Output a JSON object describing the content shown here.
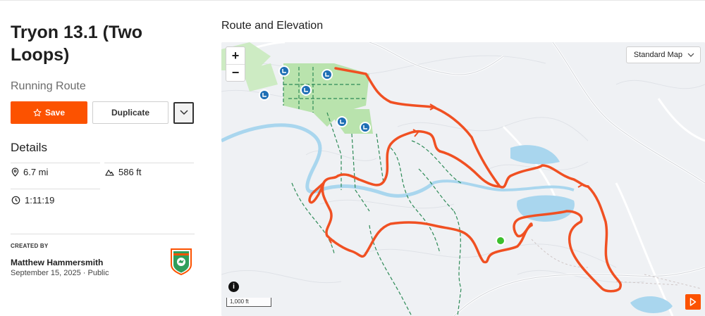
{
  "route": {
    "title": "Tryon 13.1 (Two Loops)",
    "type": "Running Route"
  },
  "actions": {
    "save_label": "Save",
    "duplicate_label": "Duplicate"
  },
  "details": {
    "heading": "Details",
    "distance": "6.7 mi",
    "elevation": "586 ft",
    "time": "1:11:19"
  },
  "creator": {
    "label": "CREATED BY",
    "name": "Matthew Hammersmith",
    "date": "September 15, 2025",
    "visibility": "Public"
  },
  "map": {
    "heading": "Route and Elevation",
    "zoom_in": "+",
    "zoom_out": "−",
    "style_selected": "Standard Map",
    "info": "i",
    "scale": "1,000 ft"
  },
  "colors": {
    "accent": "#fc5200",
    "route": "#f05022",
    "water": "#a9d6ee",
    "park": "#b9e3ad",
    "trail": "#2e8b57",
    "poi": "#1f6fb5"
  },
  "icons": {
    "save": "star-outline-icon",
    "more": "chevron-down-icon",
    "distance": "location-pin-icon",
    "elevation": "mountain-icon",
    "time": "clock-icon",
    "badge": "shield-badge-icon",
    "play": "play-icon"
  }
}
